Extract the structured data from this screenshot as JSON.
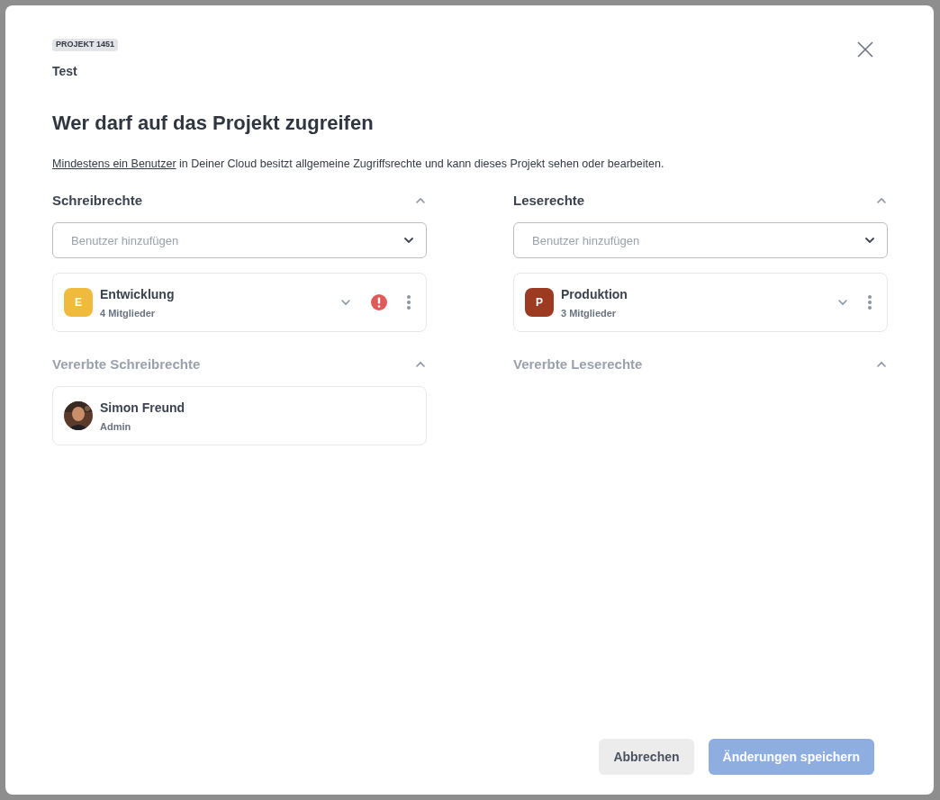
{
  "dialog": {
    "badge": "PROJEKT 1451",
    "project_name": "Test",
    "title": "Wer darf auf das Projekt zugreifen",
    "intro": {
      "link": "Mindestens ein Benutzer",
      "text": " in Deiner Cloud besitzt allgemeine Zugriffsrechte und kann dieses Projekt sehen oder bearbeiten."
    }
  },
  "columns": [
    {
      "title": "Schreibrechte",
      "expanded": true,
      "placeholder": "Benutzer hinzufügen",
      "members": [
        {
          "kind": "group",
          "initial": "E",
          "color": "#f0bb3c",
          "name": "Entwicklung",
          "subtitle": "4 Mitglieder",
          "warning": true
        }
      ],
      "inherited": {
        "title": "Vererbte Schreibrechte",
        "expanded": true,
        "members": [
          {
            "kind": "user",
            "name": "Simon Freund",
            "subtitle": "Admin",
            "warning": false
          }
        ]
      }
    },
    {
      "title": "Leserechte",
      "expanded": true,
      "placeholder": "Benutzer hinzufügen",
      "members": [
        {
          "kind": "group",
          "initial": "P",
          "color": "#9c3a22",
          "name": "Produktion",
          "subtitle": "3 Mitglieder",
          "warning": false
        }
      ],
      "inherited": {
        "title": "Vererbte Leserechte",
        "expanded": true
      }
    }
  ],
  "buttons": [
    {
      "label": "Abbrechen",
      "kind": "secondary",
      "disabled": false
    },
    {
      "label": "Änderungen speichern",
      "kind": "primary",
      "disabled": true
    }
  ]
}
